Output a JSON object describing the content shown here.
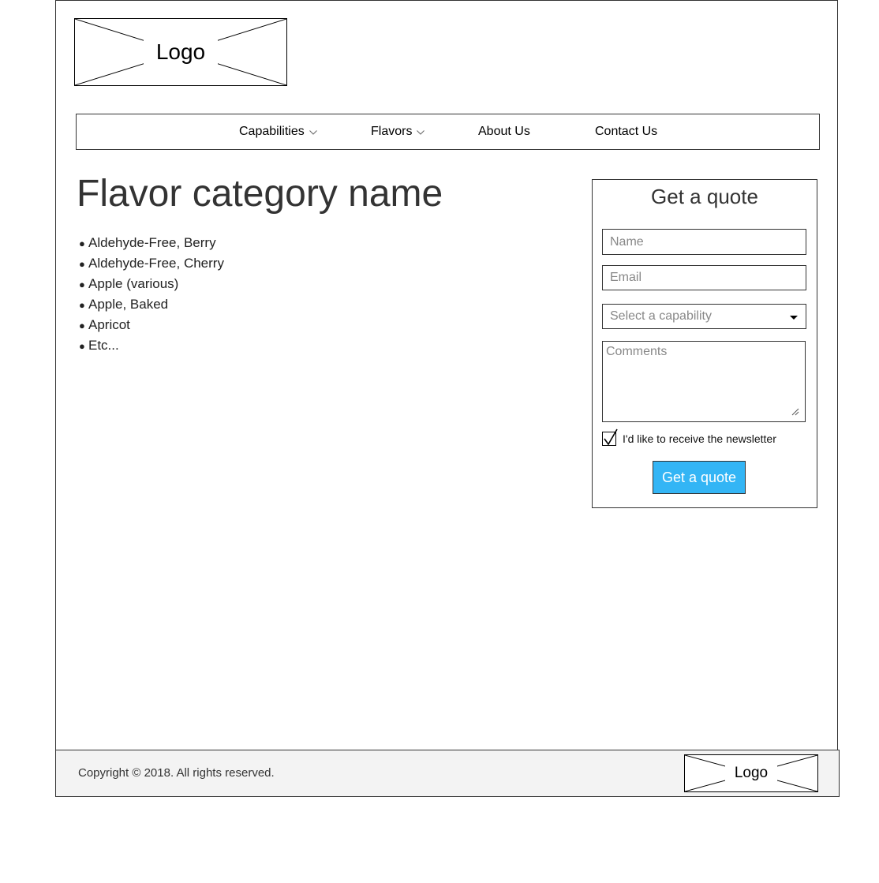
{
  "header": {
    "logo_text": "Logo"
  },
  "nav": {
    "items": [
      {
        "label": "Capabilities"
      },
      {
        "label": "Flavors"
      },
      {
        "label": "About Us"
      },
      {
        "label": "Contact Us"
      }
    ]
  },
  "main": {
    "title": "Flavor category name",
    "flavors": [
      "Aldehyde-Free, Berry",
      "Aldehyde-Free, Cherry",
      "Apple (various)",
      "Apple, Baked",
      "Apricot",
      "Etc..."
    ]
  },
  "quote_form": {
    "title": "Get a quote",
    "name_placeholder": "Name",
    "email_placeholder": "Email",
    "capability_placeholder": "Select a capability",
    "comments_placeholder": "Comments",
    "newsletter_checked": true,
    "newsletter_label": "I'd like to receive the newsletter",
    "submit_label": "Get a quote",
    "submit_color": "#33b5f5"
  },
  "footer": {
    "copyright": "Copyright © 2018. All rights reserved.",
    "logo_text": "Logo"
  }
}
